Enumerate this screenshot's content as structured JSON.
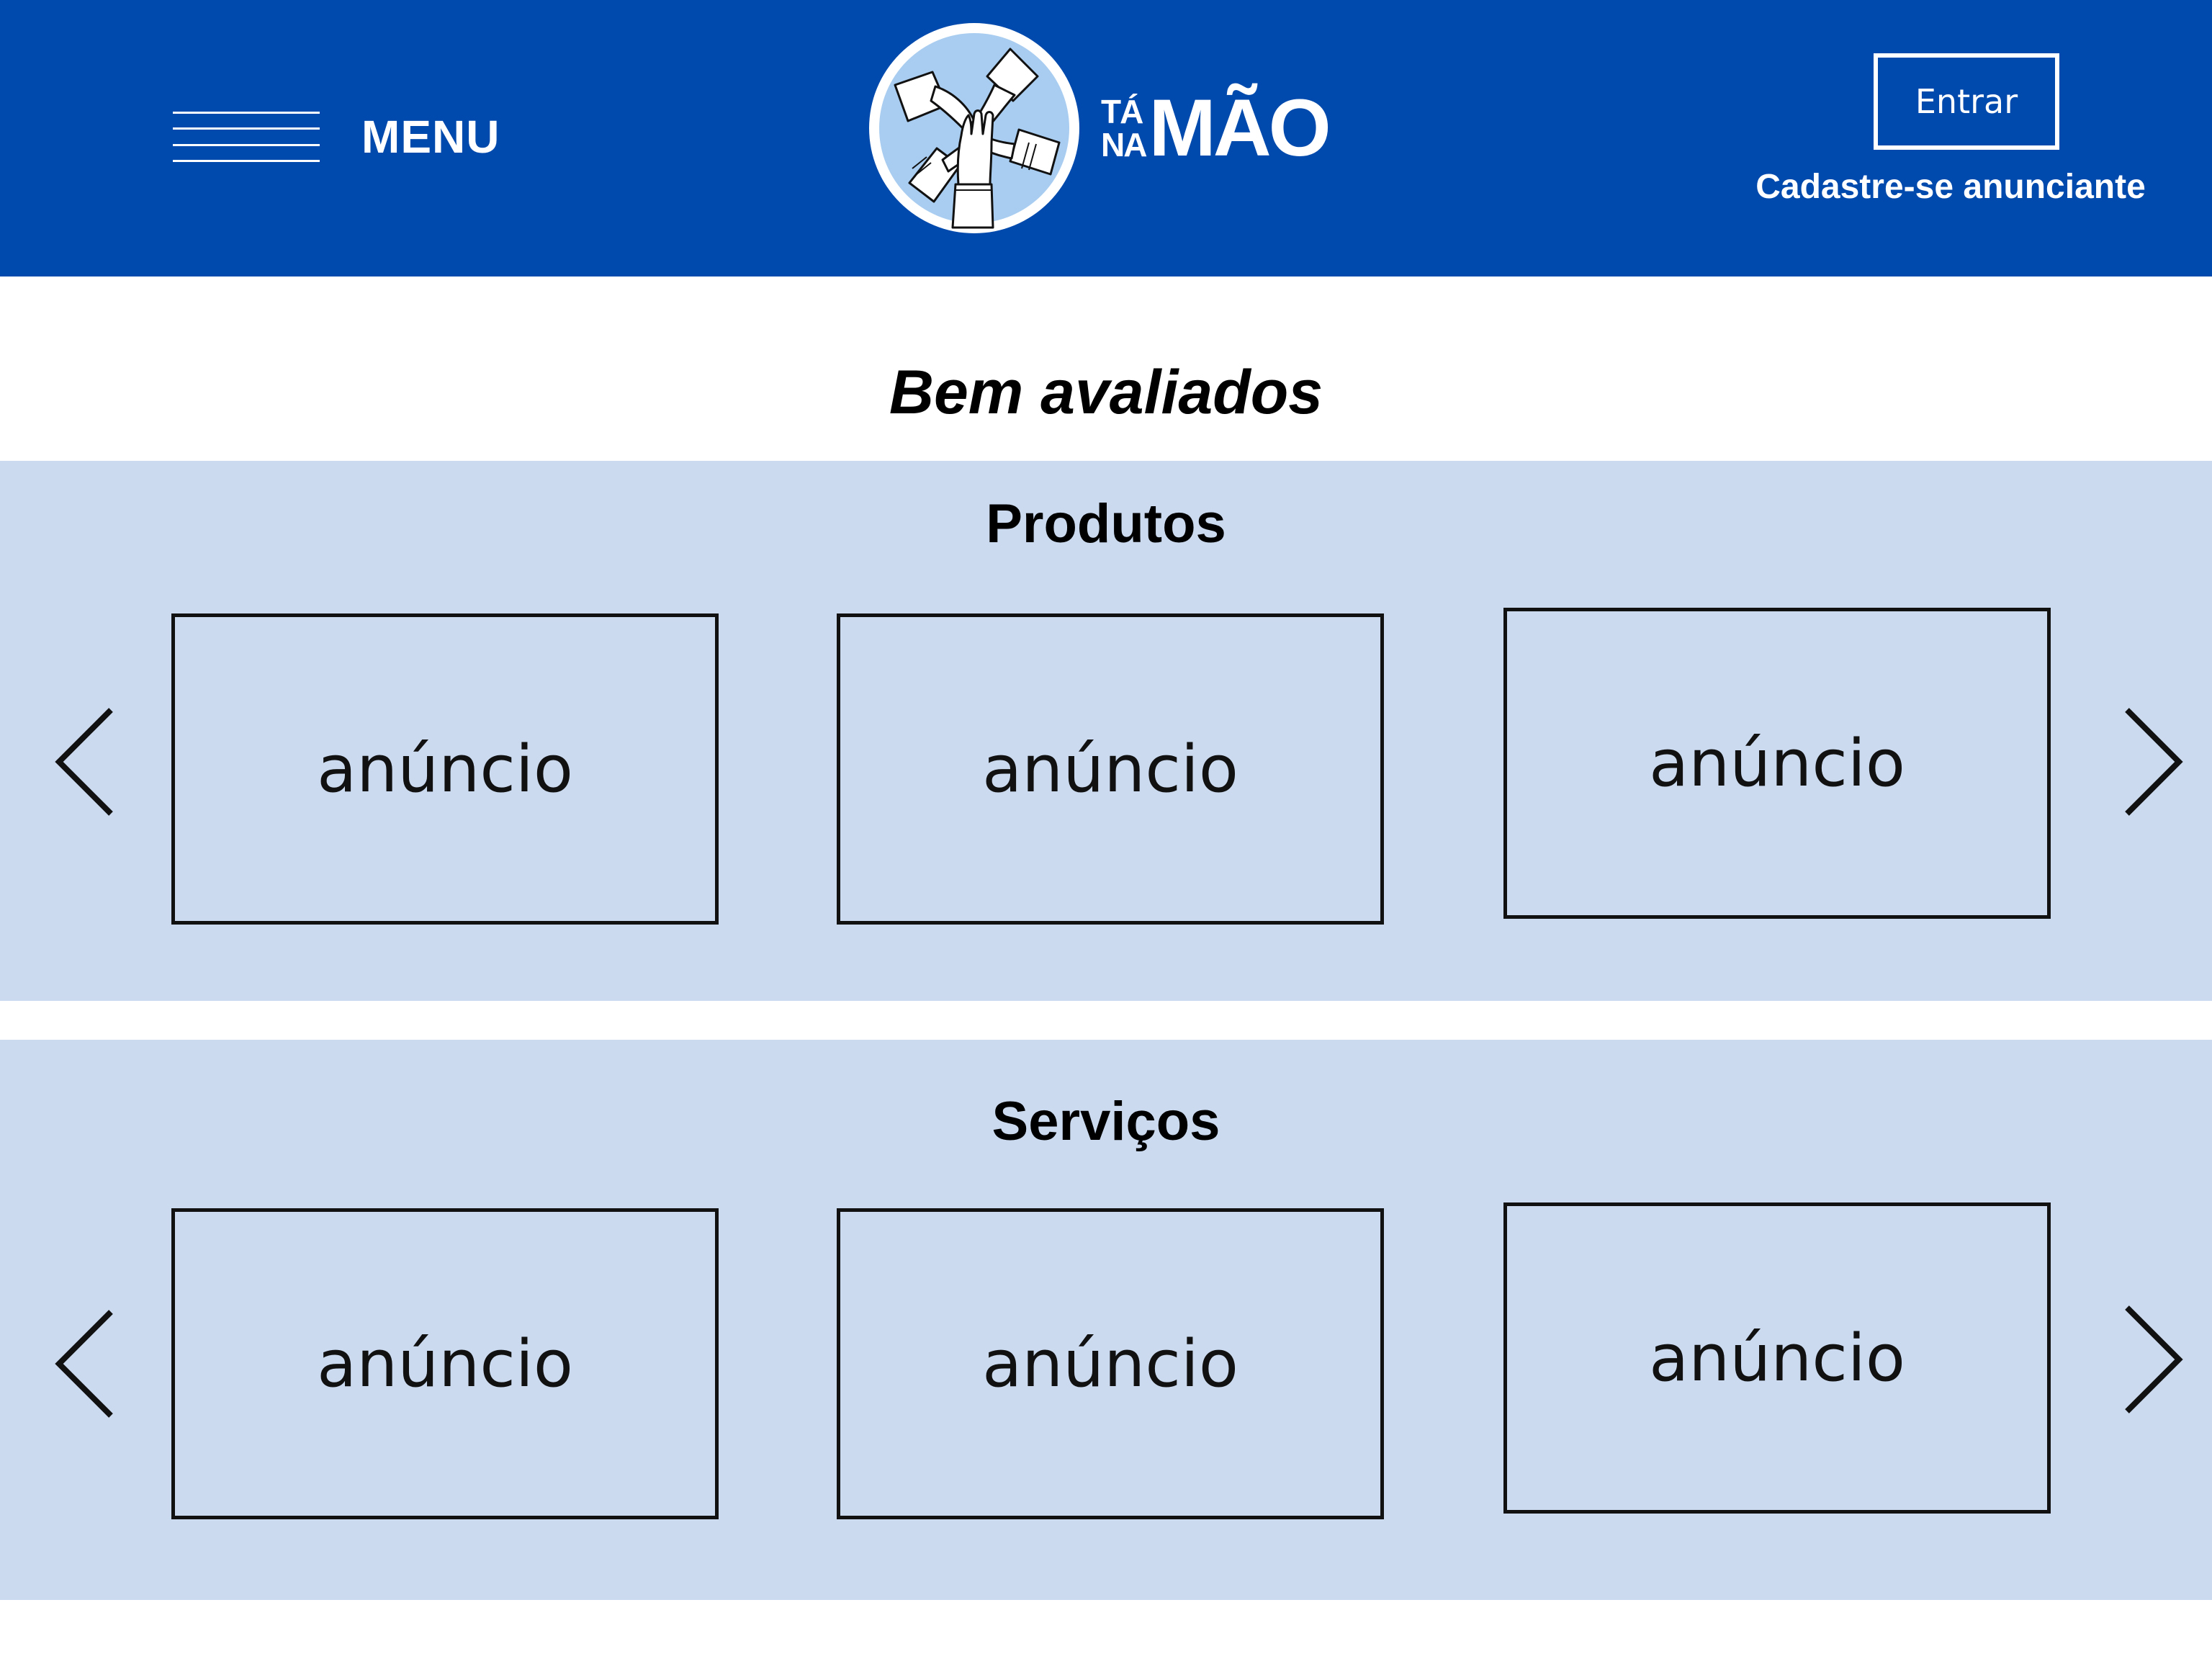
{
  "header": {
    "menu_label": "MENU",
    "logo": {
      "small_top": "TÁ",
      "small_bottom": "NA",
      "big": "MÃO"
    },
    "login_label": "Entrar",
    "register_label": "Cadastre-se anunciante"
  },
  "colors": {
    "header_bg": "#014AAD",
    "section_bg": "#CBDAEF",
    "logo_circle": "#A9CDF0"
  },
  "main": {
    "title": "Bem avaliados",
    "sections": [
      {
        "title": "Produtos",
        "cards": [
          {
            "label": "anúncio"
          },
          {
            "label": "anúncio"
          },
          {
            "label": "anúncio"
          }
        ],
        "prev_icon": "chevron-left-icon",
        "next_icon": "chevron-right-icon"
      },
      {
        "title": "Serviços",
        "cards": [
          {
            "label": "anúncio"
          },
          {
            "label": "anúncio"
          },
          {
            "label": "anúncio"
          }
        ],
        "prev_icon": "chevron-left-icon",
        "next_icon": "chevron-right-icon"
      }
    ]
  }
}
